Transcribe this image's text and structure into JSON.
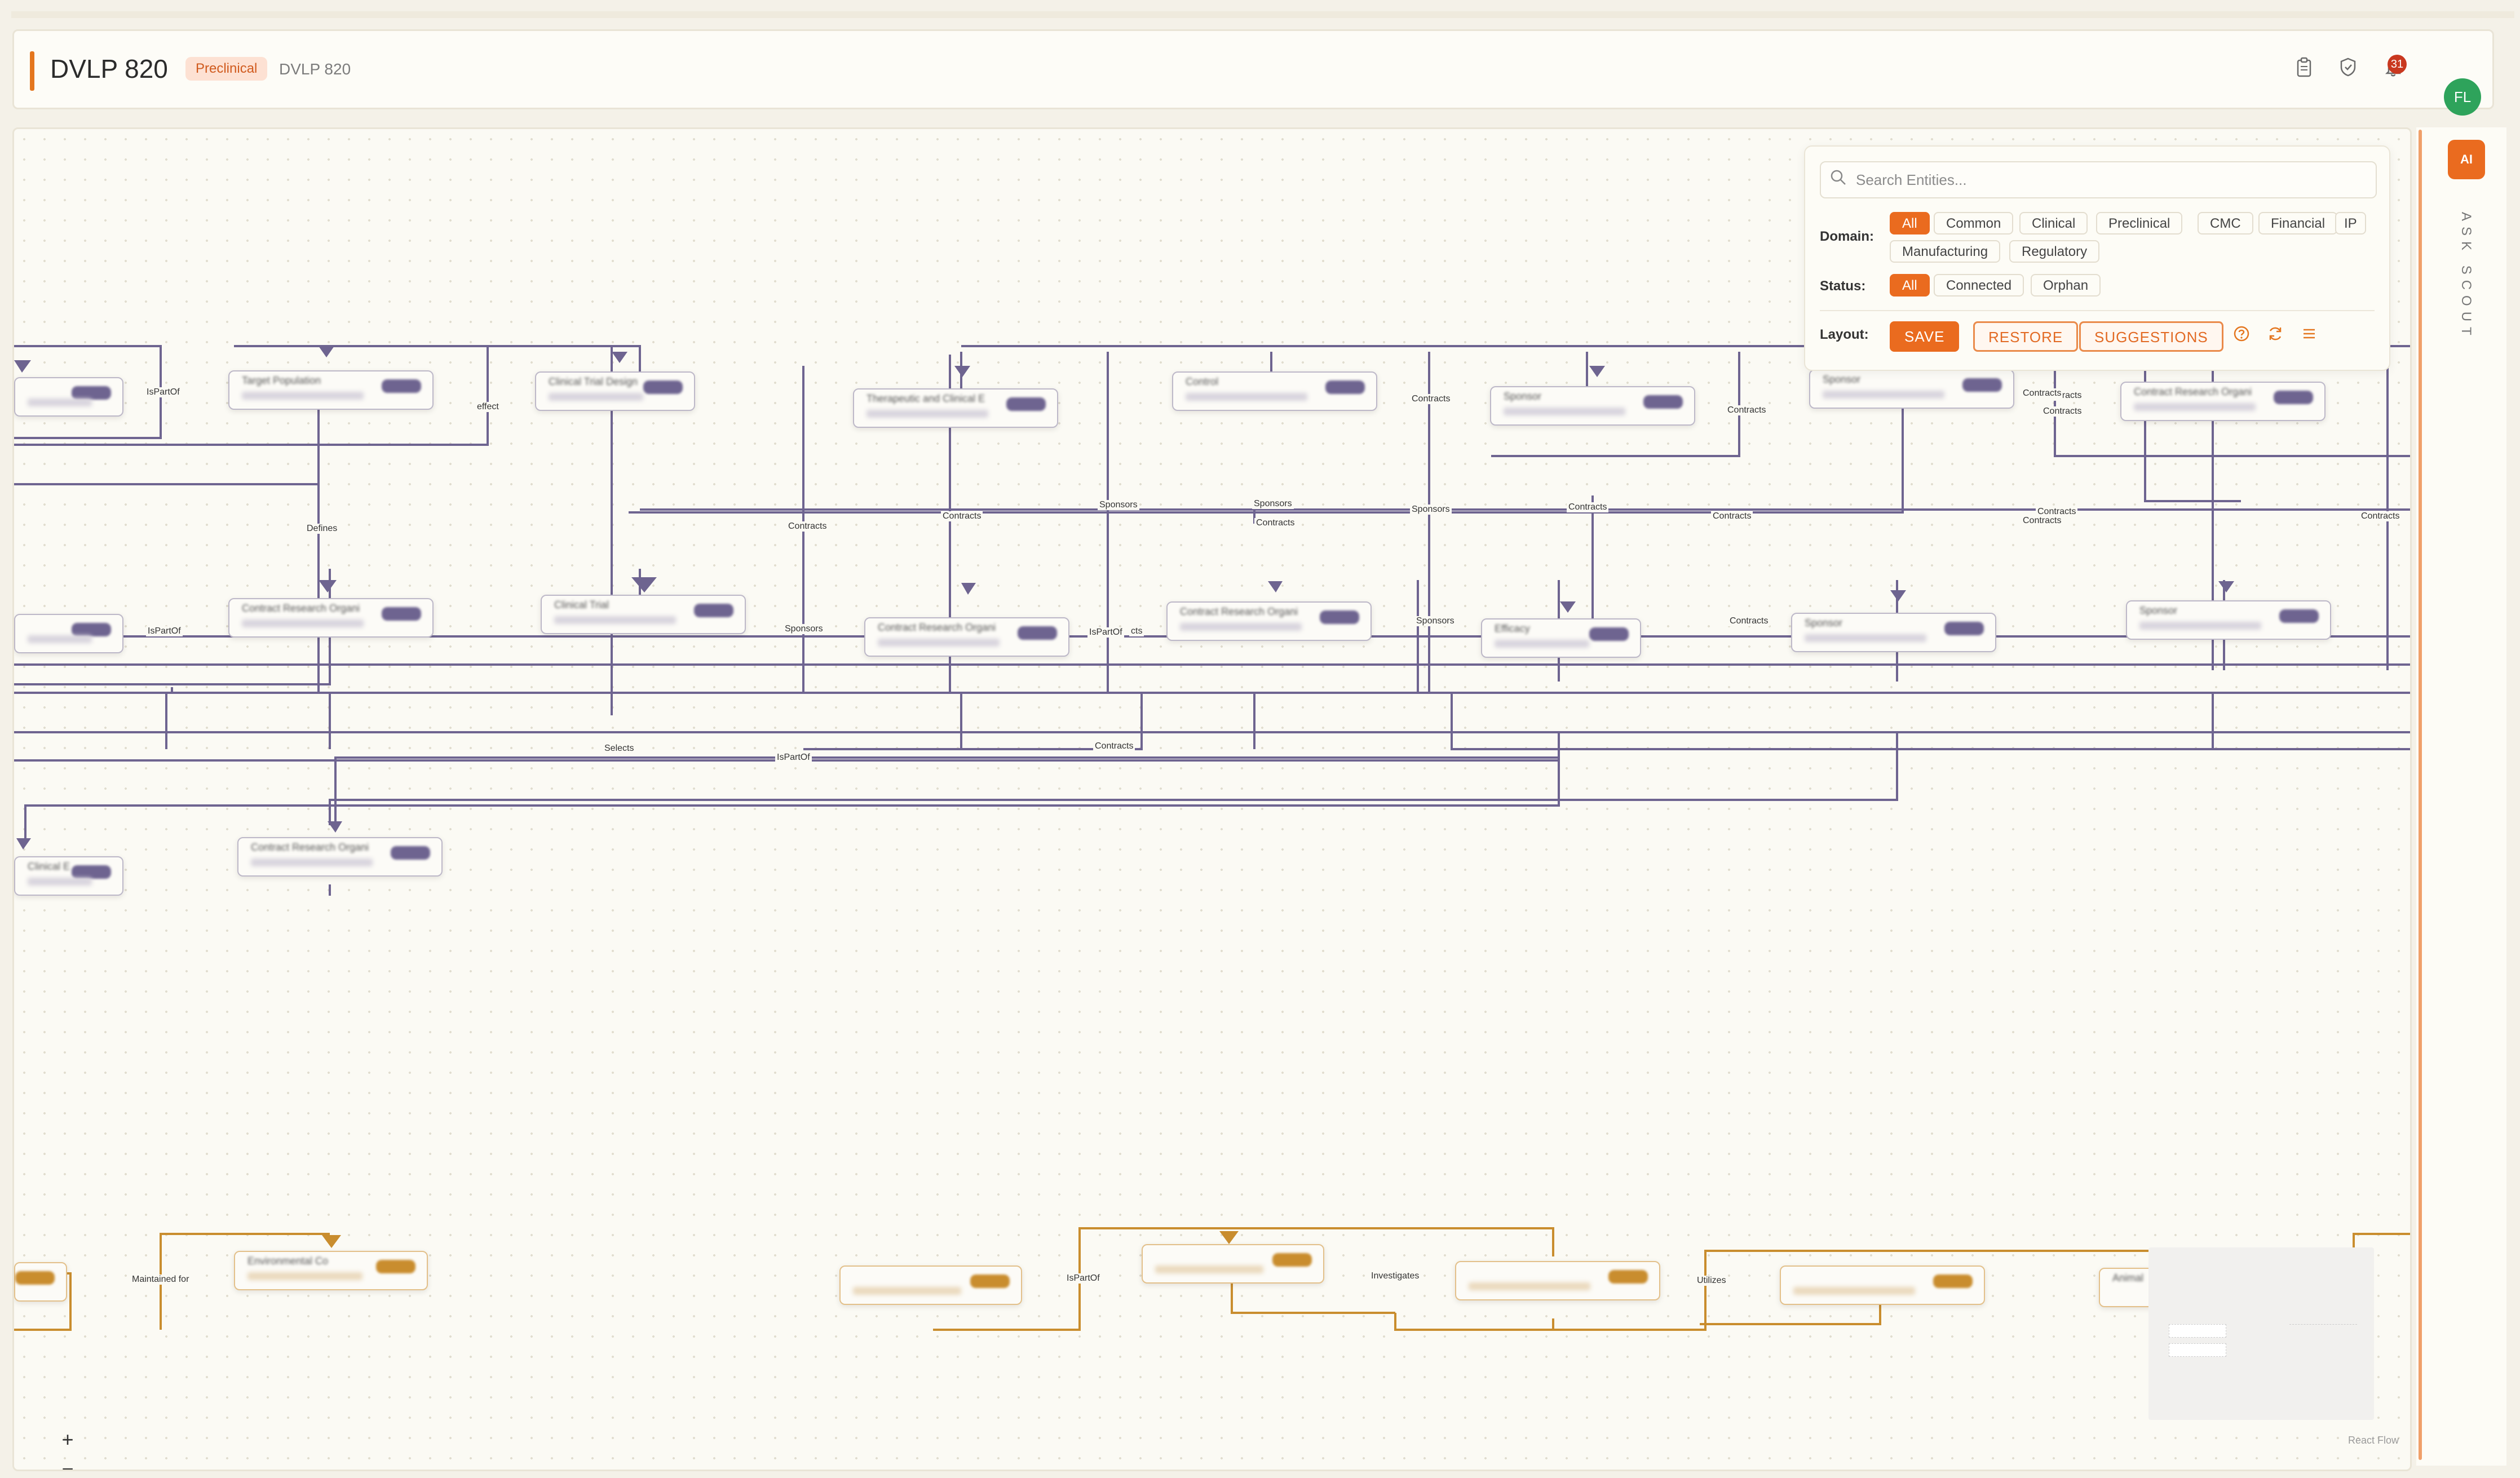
{
  "header": {
    "title": "DVLP 820",
    "phase_badge": "Preclinical",
    "subtitle": "DVLP 820",
    "notification_count": "31",
    "avatar_initials": "FL"
  },
  "filters": {
    "search_placeholder": "Search Entities...",
    "domain_label": "Domain:",
    "domain_options": [
      "All",
      "Common",
      "Clinical",
      "Preclinical",
      "CMC",
      "Financial",
      "IP",
      "Manufacturing",
      "Regulatory"
    ],
    "domain_selected": "All",
    "status_label": "Status:",
    "status_options": [
      "All",
      "Connected",
      "Orphan"
    ],
    "status_selected": "All",
    "layout_label": "Layout:",
    "layout_buttons": [
      "SAVE",
      "RESTORE",
      "SUGGESTIONS"
    ]
  },
  "graph": {
    "nodes": [
      "Target Population",
      "Clinical Trial Design",
      "Therapeutic and Clinical E",
      "Control",
      "Sponsor",
      "Sponsor",
      "Contract Research Organi",
      "Contract Research Organi",
      "Clinical Trial",
      "Contract Research Organi",
      "Contract Research Organi",
      "Efficacy",
      "Sponsor",
      "Sponsor",
      "Clinical E",
      "Contract Research Organi",
      "Environmental Co",
      "Animal"
    ],
    "edge_labels": [
      "IsPartOf",
      "effect",
      "Contracts",
      "Contracts",
      "Contracts",
      "Contracts",
      "Defines",
      "Contracts",
      "Sponsors",
      "Sponsors",
      "Sponsors",
      "Contracts",
      "Contracts",
      "Contracts",
      "Contracts",
      "Contracts",
      "Contracts",
      "Contracts",
      "IsPartOf",
      "Sponsors",
      "IsPartOf",
      "Sponsors",
      "Contracts",
      "Selects",
      "Contracts",
      "IsPartOf",
      "Maintained for",
      "IsPartOf",
      "Investigates",
      "Utilizes",
      "cts",
      "Contracts"
    ]
  },
  "controls": {
    "zoom_in": "+",
    "zoom_out": "−",
    "fit_view": "⛶",
    "lock": "🔒"
  },
  "attribution": "React Flow",
  "side_panel": {
    "ai_button": "AI",
    "ask_label": "ASK SCOUT"
  },
  "colors": {
    "accent": "#ea6b1f",
    "edge_purple": "#6e6490",
    "edge_gold": "#c98d2e",
    "avatar": "#2ea35b"
  }
}
